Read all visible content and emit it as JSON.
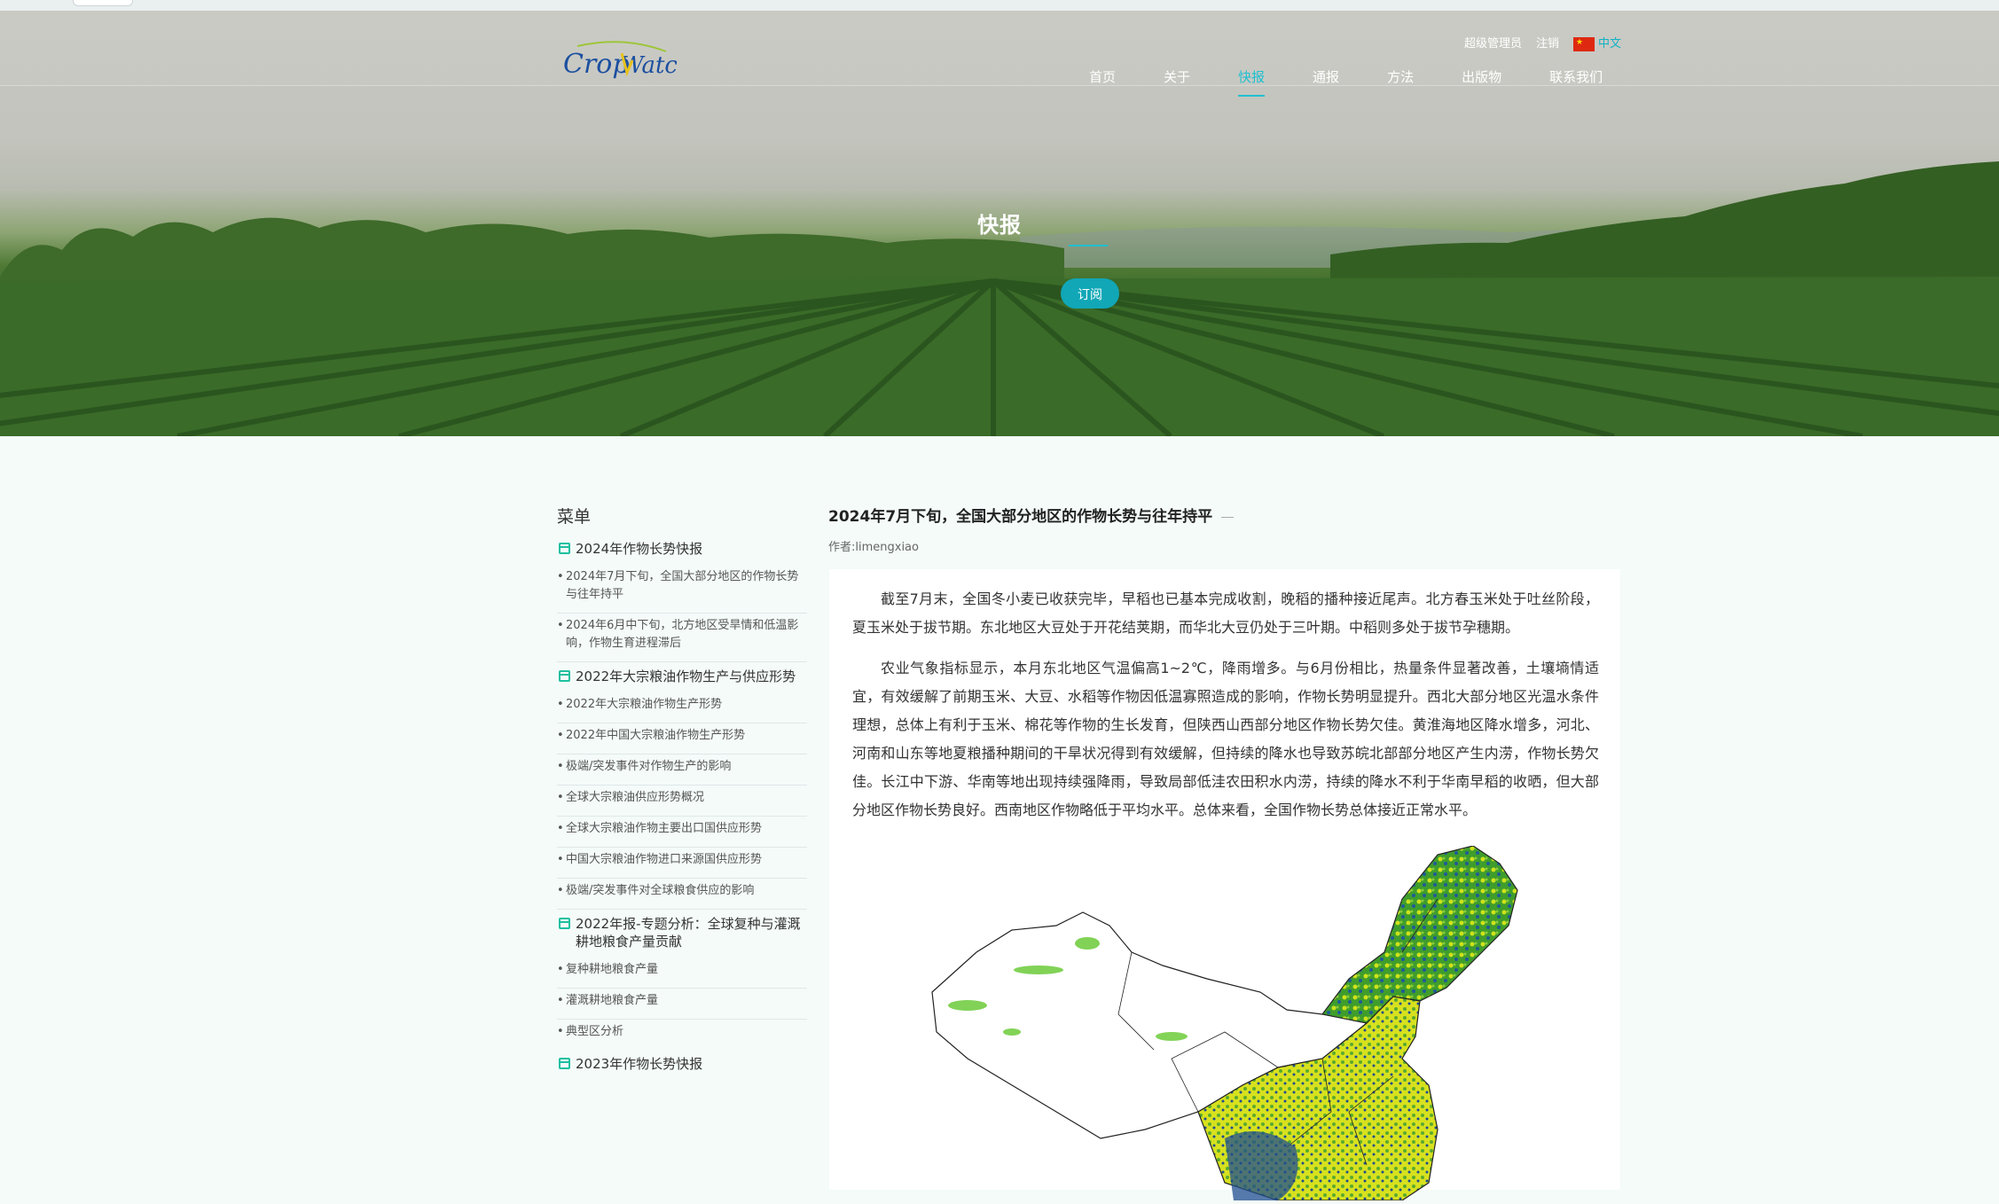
{
  "header": {
    "logo_text": "CropWatch",
    "top_links": [
      "超级管理员",
      "注销"
    ],
    "language": "中文",
    "nav": [
      {
        "label": "首页",
        "active": false
      },
      {
        "label": "关于",
        "active": false
      },
      {
        "label": "快报",
        "active": true
      },
      {
        "label": "通报",
        "active": false
      },
      {
        "label": "方法",
        "active": false
      },
      {
        "label": "出版物",
        "active": false
      },
      {
        "label": "联系我们",
        "active": false
      }
    ]
  },
  "hero": {
    "title": "快报",
    "subscribe_label": "订阅"
  },
  "sidebar": {
    "title": "菜单",
    "groups": [
      {
        "label": "2024年作物长势快报",
        "items": [
          "2024年7月下旬，全国大部分地区的作物长势与往年持平",
          "2024年6月中下旬，北方地区受旱情和低温影响，作物生育进程滞后"
        ]
      },
      {
        "label": "2022年大宗粮油作物生产与供应形势",
        "items": [
          "2022年大宗粮油作物生产形势",
          "2022年中国大宗粮油作物生产形势",
          "极端/突发事件对作物生产的影响",
          "全球大宗粮油供应形势概况",
          "全球大宗粮油作物主要出口国供应形势",
          "中国大宗粮油作物进口来源国供应形势",
          "极端/突发事件对全球粮食供应的影响"
        ]
      },
      {
        "label": "2022年报-专题分析：全球复种与灌溉耕地粮食产量贡献",
        "items": [
          "复种耕地粮食产量",
          "灌溉耕地粮食产量",
          "典型区分析"
        ]
      },
      {
        "label": "2023年作物长势快报",
        "items": []
      }
    ]
  },
  "article": {
    "title": "2024年7月下旬，全国大部分地区的作物长势与往年持平",
    "author": "作者:limengxiao",
    "paragraphs": [
      "截至7月末，全国冬小麦已收获完毕，早稻也已基本完成收割，晚稻的播种接近尾声。北方春玉米处于吐丝阶段，夏玉米处于拔节期。东北地区大豆处于开花结荚期，而华北大豆仍处于三叶期。中稻则多处于拔节孕穗期。",
      "农业气象指标显示，本月东北地区气温偏高1~2℃，降雨增多。与6月份相比，热量条件显著改善，土壤墒情适宜，有效缓解了前期玉米、大豆、水稻等作物因低温寡照造成的影响，作物长势明显提升。西北大部分地区光温水条件理想，总体上有利于玉米、棉花等作物的生长发育，但陕西山西部分地区作物长势欠佳。黄淮海地区降水增多，河北、河南和山东等地夏粮播种期间的干旱状况得到有效缓解，但持续的降水也导致苏皖北部部分地区产生内涝，作物长势欠佳。长江中下游、华南等地出现持续强降雨，导致局部低洼农田积水内涝，持续的降水不利于华南早稻的收晒，但大部分地区作物长势良好。西南地区作物略低于平均水平。总体来看，全国作物长势总体接近正常水平。"
    ]
  },
  "colors": {
    "accent": "#1ec0d0",
    "button": "#11a7b7",
    "calendar_icon": "#1ec0a0"
  }
}
